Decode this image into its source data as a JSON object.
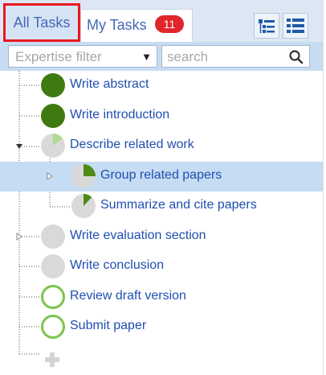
{
  "tabs": {
    "all_tasks": "All Tasks",
    "my_tasks": "My Tasks",
    "my_tasks_count": "11"
  },
  "filter": {
    "expertise_placeholder": "Expertise filter",
    "search_placeholder": "search"
  },
  "tasks": [
    {
      "label": "Write abstract",
      "progress": 1.0,
      "status": "complete"
    },
    {
      "label": "Write introduction",
      "progress": 1.0,
      "status": "complete"
    },
    {
      "label": "Describe related work",
      "progress": 0.15,
      "status": "in-progress",
      "expanded": true
    },
    {
      "label": "Group related papers",
      "progress": 0.25,
      "status": "in-progress",
      "selected": true
    },
    {
      "label": "Summarize and cite papers",
      "progress": 0.12,
      "status": "in-progress"
    },
    {
      "label": "Write evaluation section",
      "progress": 0,
      "status": "not-started"
    },
    {
      "label": "Write conclusion",
      "progress": 0,
      "status": "not-started"
    },
    {
      "label": "Review draft version",
      "progress": 0,
      "status": "ready"
    },
    {
      "label": "Submit paper",
      "progress": 0,
      "status": "ready"
    }
  ],
  "icons": {
    "view_buttons": [
      "tree-view-icon",
      "list-view-icon"
    ],
    "search": "magnifier-icon",
    "add": "plus-icon"
  },
  "colors": {
    "complete": "#3f7a10",
    "progress_fill": "#4f8a17",
    "progress_light": "#b2d992",
    "not_started": "#d9d9d9",
    "ready_ring": "#7cc54e",
    "badge": "#e0262b",
    "highlight_border": "#e8191f",
    "selected_row": "#c6dcf3"
  }
}
